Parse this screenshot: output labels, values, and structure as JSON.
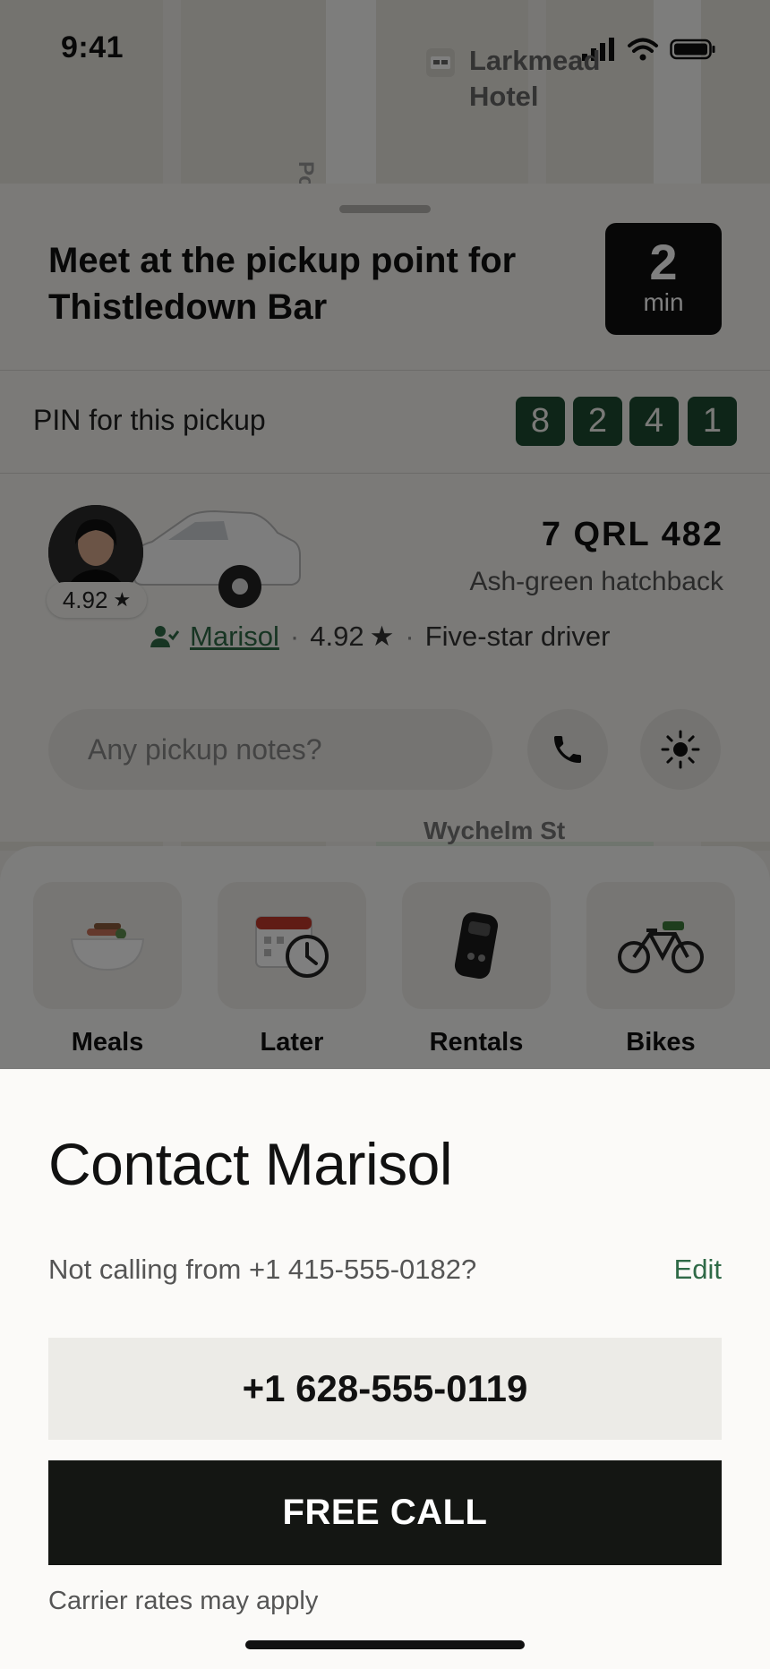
{
  "status_bar": {
    "time": "9:41"
  },
  "map": {
    "poi_label": "Larkmead Hotel",
    "poi_line1": "Larkmead",
    "poi_line2": "Hotel",
    "street_vertical": "Polk",
    "street_horizontal": "Wychelm St"
  },
  "trip": {
    "title_line1": "Meet at the pickup point for",
    "title_line2": "Thistledown Bar",
    "eta_value": "2",
    "eta_unit": "min"
  },
  "pin": {
    "label": "PIN for this pickup",
    "digits": [
      "8",
      "2",
      "4",
      "1"
    ]
  },
  "driver": {
    "avatar_rating": "4.92",
    "plate": "7 QRL 482",
    "vehicle": "Ash-green hatchback",
    "name": "Marisol",
    "rating": "4.92",
    "badge": "Five-star driver"
  },
  "actions": {
    "notes_placeholder": "Any pickup notes?",
    "call_icon": "phone-icon",
    "light_icon": "sun-icon"
  },
  "services": [
    {
      "label": "Meals",
      "icon": "bowl-icon"
    },
    {
      "label": "Later",
      "icon": "calendar-clock-icon"
    },
    {
      "label": "Rentals",
      "icon": "key-fob-icon"
    },
    {
      "label": "Bikes",
      "icon": "bike-icon"
    }
  ],
  "contact": {
    "title": "Contact Marisol",
    "not_calling_text": "Not calling from +1 415-555-0182?",
    "edit_label": "Edit",
    "phone_number": "+1 628-555-0119",
    "call_button": "FREE CALL",
    "footnote": "Carrier rates may apply"
  },
  "colors": {
    "accent_green": "#1c4a30",
    "link_green": "#2f6a47",
    "call_button_bg": "#141613"
  }
}
